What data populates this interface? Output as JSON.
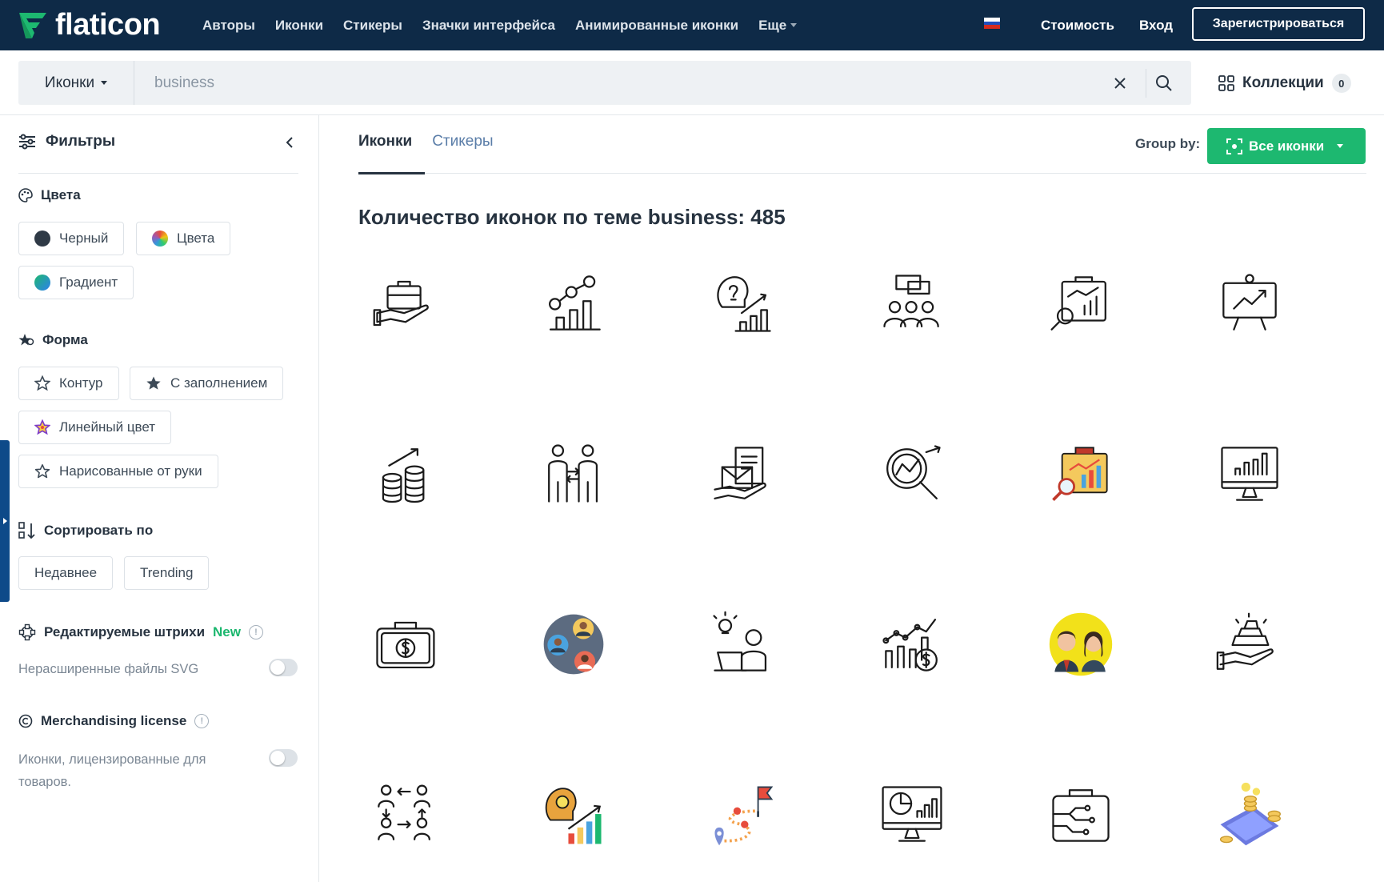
{
  "nav": {
    "logo_text": "flaticon",
    "links": [
      "Авторы",
      "Иконки",
      "Стикеры",
      "Значки интерфейса",
      "Анимированные иконки"
    ],
    "more": "Еще",
    "pricing": "Стоимость",
    "login": "Вход",
    "signup": "Зарегистрироваться"
  },
  "search": {
    "type_label": "Иконки",
    "value": "business",
    "collections_label": "Коллекции",
    "collections_count": "0"
  },
  "sidebar": {
    "filters_title": "Фильтры",
    "colors": {
      "title": "Цвета",
      "options": [
        "Черный",
        "Цвета",
        "Градиент"
      ]
    },
    "shape": {
      "title": "Форма",
      "options": [
        "Контур",
        "С заполнением",
        "Линейный цвет",
        "Нарисованные от руки"
      ]
    },
    "sort": {
      "title": "Сортировать по",
      "options": [
        "Недавнее",
        "Trending"
      ]
    },
    "strokes": {
      "title": "Редактируемые штрихи",
      "new_tag": "New",
      "toggle_label": "Нерасширенные файлы SVG"
    },
    "merch": {
      "title": "Merchandising license",
      "toggle_label_line1": "Иконки, лицензированные для",
      "toggle_label_line2": "товаров."
    }
  },
  "main": {
    "tabs": [
      "Иконки",
      "Стикеры"
    ],
    "groupby_label": "Group by:",
    "groupby_value": "Все иконки",
    "title": "Количество иконок по теме business: 485"
  },
  "icons": [
    "briefcase-in-hand-icon",
    "dollar-growth-chart-icon",
    "idea-head-chart-icon",
    "team-discussion-icon",
    "briefcase-analytics-icon",
    "presentation-board-icon",
    "coins-growth-icon",
    "business-partners-icon",
    "envelope-document-icon",
    "magnifier-analytics-icon",
    "colored-briefcase-analytics-icon",
    "monitor-bar-chart-icon",
    "money-briefcase-icon",
    "team-network-icon",
    "idea-laptop-person-icon",
    "dollar-analytics-icon",
    "business-couple-icon",
    "gold-bars-hand-icon",
    "workflow-people-icon",
    "idea-head-growth-icon",
    "roadmap-flag-icon",
    "monitor-pie-chart-icon",
    "circuit-briefcase-icon",
    "coins-phone-icon"
  ],
  "colors": {
    "nav_bg": "#0e2a47",
    "accent_green": "#1db870",
    "search_bg": "#eef1f4"
  }
}
